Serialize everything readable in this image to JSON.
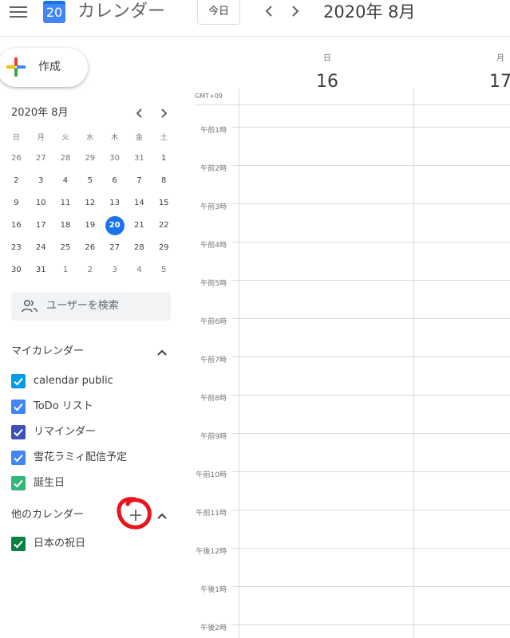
{
  "header": {
    "app_title": "カレンダー",
    "logo_day": "20",
    "today_label": "今日",
    "current_date": "2020年 8月"
  },
  "create": {
    "label": "作成"
  },
  "mini_calendar": {
    "title": "2020年 8月",
    "weekdays": [
      "日",
      "月",
      "火",
      "水",
      "木",
      "金",
      "土"
    ],
    "weeks": [
      [
        "26",
        "27",
        "28",
        "29",
        "30",
        "31",
        "1"
      ],
      [
        "2",
        "3",
        "4",
        "5",
        "6",
        "7",
        "8"
      ],
      [
        "9",
        "10",
        "11",
        "12",
        "13",
        "14",
        "15"
      ],
      [
        "16",
        "17",
        "18",
        "19",
        "20",
        "21",
        "22"
      ],
      [
        "23",
        "24",
        "25",
        "26",
        "27",
        "28",
        "29"
      ],
      [
        "30",
        "31",
        "1",
        "2",
        "3",
        "4",
        "5"
      ]
    ],
    "today": "20"
  },
  "search_people": {
    "placeholder": "ユーザーを検索"
  },
  "my_calendars": {
    "title": "マイカレンダー",
    "items": [
      {
        "label": "calendar public",
        "color": "#039be5"
      },
      {
        "label": "ToDo リスト",
        "color": "#4285f4"
      },
      {
        "label": "リマインダー",
        "color": "#3f51b5"
      },
      {
        "label": "雪花ラミィ配信予定",
        "color": "#4285f4"
      },
      {
        "label": "誕生日",
        "color": "#33b679"
      }
    ]
  },
  "other_calendars": {
    "title": "他のカレンダー",
    "items": [
      {
        "label": "日本の祝日",
        "color": "#0b8043"
      }
    ]
  },
  "week_view": {
    "timezone": "GMT+09",
    "days": [
      {
        "name": "日",
        "number": "16"
      },
      {
        "name": "月",
        "number": "17"
      }
    ],
    "hours": [
      "午前1時",
      "午前2時",
      "午前3時",
      "午前4時",
      "午前5時",
      "午前6時",
      "午前7時",
      "午前8時",
      "午前9時",
      "午前10時",
      "午前11時",
      "午後12時",
      "午後1時",
      "午後2時"
    ]
  },
  "colors": {
    "accent": "#1a73e8",
    "annotation": "#e8141b"
  }
}
